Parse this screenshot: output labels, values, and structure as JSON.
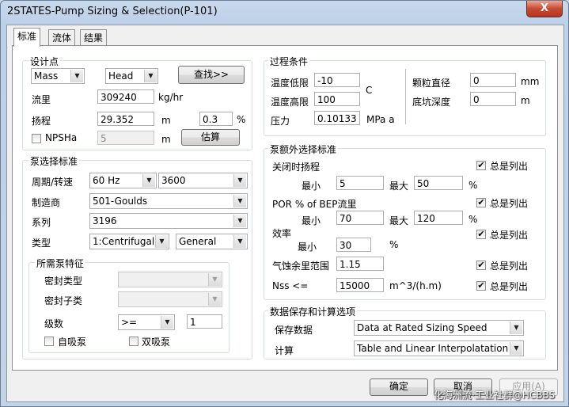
{
  "window": {
    "title": "2STATES-Pump Sizing & Selection(P-101)",
    "close_label": "X"
  },
  "tabs": [
    {
      "label": "标准"
    },
    {
      "label": "流体"
    },
    {
      "label": "结果"
    }
  ],
  "design_point": {
    "legend": "设计点",
    "flow_basis": "Mass",
    "head_basis": "Head",
    "find_button": "查找>>",
    "flow_label": "流里",
    "flow_value": "309240",
    "flow_unit": "kg/hr",
    "head_label": "扬程",
    "head_value": "29.352",
    "head_unit": "m",
    "head_margin": "0.3",
    "head_margin_unit": "%",
    "npsha_label": "NPSHa",
    "npsha_value": "5",
    "npsha_unit": "m",
    "estimate_button": "估算"
  },
  "process": {
    "legend": "过程条件",
    "tmin_label": "温度低限",
    "tmin_value": "-10",
    "tmax_label": "温度高限",
    "tmax_value": "100",
    "temp_unit": "C",
    "pressure_label": "压力",
    "pressure_value": "0.10133",
    "pressure_unit": "MPa a",
    "particle_label": "颗粒直径",
    "particle_value": "0",
    "particle_unit": "mm",
    "depth_label": "底坑深度",
    "depth_value": "0",
    "depth_unit": "m"
  },
  "pump_criteria": {
    "legend": "泵选择标准",
    "freq_label": "周期/转速",
    "freq_value": "60 Hz",
    "speed_value": "3600",
    "vendor_label": "制造商",
    "vendor_value": "501-Goulds",
    "series_label": "系列",
    "series_value": "3196",
    "type_label": "类型",
    "type_value": "1:Centrifugal",
    "type2_value": "General"
  },
  "pump_features": {
    "legend": "所需泵特征",
    "seal_type_label": "密封类型",
    "seal_subtype_label": "密封子类",
    "stages_label": "级数",
    "stages_op": ">=",
    "stages_value": "1",
    "self_priming_label": "自吸泵",
    "double_suction_label": "双吸泵"
  },
  "extra_criteria": {
    "legend": "泵额外选择标准",
    "shutoff_label": "关闭时扬程",
    "min_label": "最小",
    "max_label": "最大",
    "shutoff_min": "5",
    "shutoff_max": "50",
    "pct": "%",
    "por_label": "POR % of BEP流里",
    "por_min": "70",
    "por_max": "120",
    "eff_label": "效率",
    "eff_min": "30",
    "npsh_margin_label": "气蚀余里范围",
    "npsh_margin_value": "1.15",
    "nss_label": "Nss <=",
    "nss_value": "15000",
    "nss_unit": "m^3/(h.m)",
    "always_list": "总是列出"
  },
  "data_options": {
    "legend": "数据保存和计算选项",
    "save_label": "保存数据",
    "save_value": "Data at Rated Sizing Speed",
    "calc_label": "计算",
    "calc_value": "Table and Linear Interpolatation"
  },
  "footer": {
    "ok": "确定",
    "cancel": "取消",
    "apply": "应用(A)"
  },
  "watermark": "化海洲流·工业社群@HCBBS"
}
